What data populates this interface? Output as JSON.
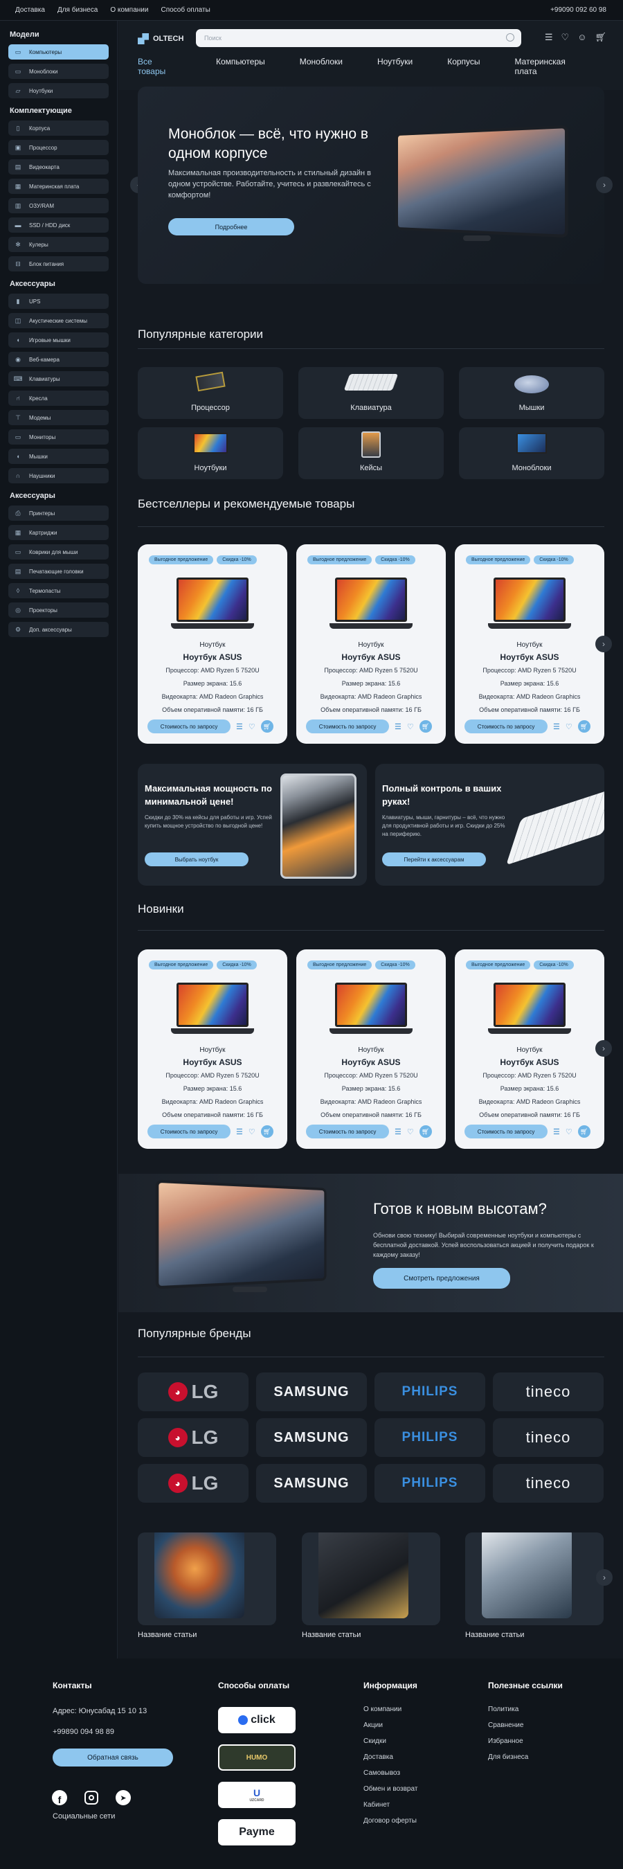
{
  "topbar": {
    "links": [
      "Доставка",
      "Для бизнеса",
      "О компании",
      "Способ оплаты"
    ],
    "phone": "+99090 092 60 98"
  },
  "sidebar": {
    "groups": [
      {
        "title": "Модели",
        "items": [
          {
            "label": "Компьютеры",
            "icon": "computer-icon",
            "active": true
          },
          {
            "label": "Моноблоки",
            "icon": "monoblock-icon"
          },
          {
            "label": "Ноутбуки",
            "icon": "laptop-icon"
          }
        ]
      },
      {
        "title": "Комплектующие",
        "items": [
          {
            "label": "Корпуса",
            "icon": "case-icon"
          },
          {
            "label": "Процессор",
            "icon": "cpu-icon"
          },
          {
            "label": "Видеокарта",
            "icon": "gpu-icon"
          },
          {
            "label": "Материнская плата",
            "icon": "motherboard-icon"
          },
          {
            "label": "ОЗУ/RAM",
            "icon": "ram-icon"
          },
          {
            "label": "SSD / HDD диск",
            "icon": "disk-icon"
          },
          {
            "label": "Кулеры",
            "icon": "cooler-icon"
          },
          {
            "label": "Блок питания",
            "icon": "power-supply-icon"
          }
        ]
      },
      {
        "title": "Аксессуары",
        "items": [
          {
            "label": "UPS",
            "icon": "ups-icon"
          },
          {
            "label": "Акустические системы",
            "icon": "speaker-icon"
          },
          {
            "label": "Игровые мышки",
            "icon": "gaming-mouse-icon"
          },
          {
            "label": "Веб-камера",
            "icon": "webcam-icon"
          },
          {
            "label": "Клавиатуры",
            "icon": "keyboard-icon"
          },
          {
            "label": "Кресла",
            "icon": "chair-icon"
          },
          {
            "label": "Модемы",
            "icon": "modem-icon"
          },
          {
            "label": "Мониторы",
            "icon": "monitor-icon"
          },
          {
            "label": "Мышки",
            "icon": "mouse-icon"
          },
          {
            "label": "Наушники",
            "icon": "headphones-icon"
          }
        ]
      },
      {
        "title": "Аксессуары",
        "items": [
          {
            "label": "Принтеры",
            "icon": "printer-icon"
          },
          {
            "label": "Картриджи",
            "icon": "cartridge-icon"
          },
          {
            "label": "Коврики для мыши",
            "icon": "mousepad-icon"
          },
          {
            "label": "Печатающие головки",
            "icon": "printhead-icon"
          },
          {
            "label": "Термопасты",
            "icon": "thermal-paste-icon"
          },
          {
            "label": "Проекторы",
            "icon": "projector-icon"
          },
          {
            "label": "Доп. аксессуары",
            "icon": "accessories-icon"
          }
        ]
      }
    ]
  },
  "header": {
    "logo": "OLTECH",
    "search_placeholder": "Поиск",
    "nav": [
      "Все товары",
      "Компьютеры",
      "Моноблоки",
      "Ноутбуки",
      "Корпусы",
      "Материнская плата"
    ]
  },
  "hero": {
    "title": "Моноблок — всё, что нужно в одном корпусе",
    "text": "Максимальная производительность и стильный дизайн в одном устройстве. Работайте, учитесь и развлекайтесь с комфортом!",
    "button": "Подробнее"
  },
  "categories": {
    "title": "Популярные категории",
    "items": [
      "Процессор",
      "Клавиатура",
      "Мышки",
      "Ноутбуки",
      "Кейсы",
      "Моноблоки"
    ]
  },
  "bestsellers": {
    "title": "Бестселлеры и рекомендуемые товары"
  },
  "new": {
    "title": "Новинки"
  },
  "product": {
    "badge1": "Выгодное предложение",
    "badge2": "Скидка -10%",
    "type": "Ноутбук",
    "name": "Ноутбук ASUS",
    "cpu": "Процессор:  AMD Ryzen 5 7520U",
    "screen": "Размер экрана:  15.6",
    "gpu": "Видеокарта:  AMD Radeon Graphics",
    "ram": "Объем оперативной памяти:  16 ГБ",
    "button": "Стоимость по запросу"
  },
  "promo1": {
    "title": "Максимальная мощность по минимальной цене!",
    "text": "Скидки до 30% на кейсы для работы и игр. Успей купить мощное устройство по выгодной цене!",
    "button": "Выбрать ноутбук"
  },
  "promo2": {
    "title": "Полный контроль в ваших руках!",
    "text": "Клавиатуры, мыши, гарнитуры – всё, что нужно для продуктивной работы и игр. Скидки до 25% на периферию.",
    "button": "Перейти к аксессуарам"
  },
  "cta": {
    "title": "Готов к новым высотам?",
    "text": "Обнови свою технику! Выбирай современные ноутбуки и компьютеры с бесплатной доставкой. Успей воспользоваться акцией и получить подарок к каждому заказу!",
    "button": "Смотреть предложения"
  },
  "brands": {
    "title": "Популярные бренды",
    "items": [
      "LG",
      "SAMSUNG",
      "PHILIPS",
      "tineco"
    ]
  },
  "articles": {
    "items": [
      "Название статьи",
      "Название статьи",
      "Название статьи"
    ]
  },
  "footer": {
    "contacts_title": "Контакты",
    "address": "Адрес: Юнусабад 15 10 13",
    "phone": "+99890 094 98 89",
    "feedback": "Обратная связь",
    "social": "Социальные сети",
    "payment_title": "Способы оплаты",
    "payments": [
      "click",
      "HUMO",
      "UZCARD",
      "Payme"
    ],
    "info_title": "Информация",
    "info": [
      "О компании",
      "Акции",
      "Скидки",
      "Доставка",
      "Самовывоз",
      "Обмен и возврат",
      "Кабинет",
      "Договор оферты"
    ],
    "links_title": "Полезные ссылки",
    "links": [
      "Политика",
      "Сравнение",
      "Избранное",
      "Для бизнеса"
    ]
  },
  "colors": {
    "accent": "#8ec6ee",
    "bg": "#141920",
    "card": "#1f262f"
  }
}
